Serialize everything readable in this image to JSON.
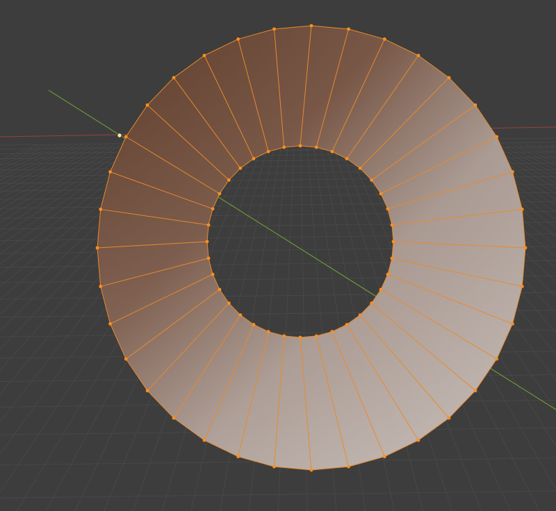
{
  "viewport": {
    "mode": "Edit Mode",
    "shading": "Solid",
    "background_color": "#3d3d3d",
    "grid_color": "#4a4a4a",
    "x_axis_color": "#9a4040",
    "y_axis_color": "#6a9a35",
    "origin_icon": "origin-dot-icon"
  },
  "mesh": {
    "type": "ring",
    "segments": 36,
    "selection": "all",
    "edge_color": "#e98a2c",
    "vertex_color": "#ff8f1e",
    "face_dark_color": "#6a4632",
    "face_light_color": "#d2cbc8"
  }
}
